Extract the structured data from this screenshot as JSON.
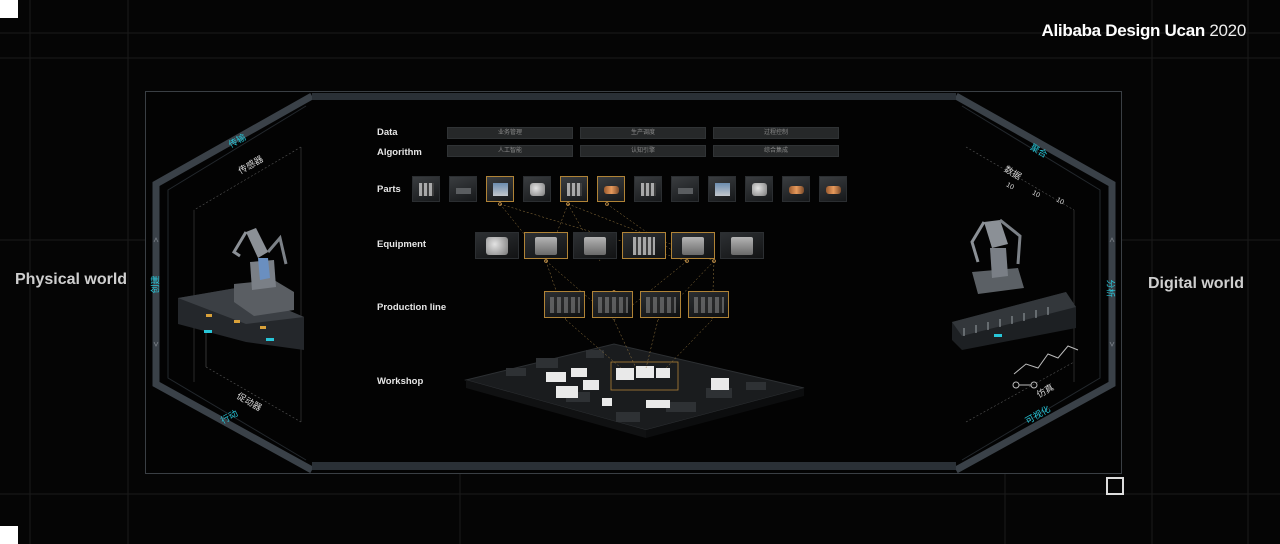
{
  "brand": {
    "name": "Alibaba Design Ucan",
    "year": "2020"
  },
  "left_title": "Physical world",
  "right_title": "Digital world",
  "rows": {
    "data": "Data",
    "algorithm": "Algorithm",
    "parts": "Parts",
    "equipment": "Equipment",
    "production_line": "Production line",
    "workshop": "Workshop"
  },
  "data_chips": [
    "业务管理",
    "生产调度",
    "过程控制"
  ],
  "algorithm_chips": [
    "人工智能",
    "认知引擎",
    "综合集成"
  ],
  "parts_tiles": [
    {
      "icon": "grid-cube-icon",
      "highlight": false
    },
    {
      "icon": "flat-plate-icon",
      "highlight": false
    },
    {
      "icon": "blue-cube-icon",
      "highlight": true
    },
    {
      "icon": "cylinder-part-icon",
      "highlight": false
    },
    {
      "icon": "grid-cube-icon",
      "highlight": true
    },
    {
      "icon": "copper-coil-icon",
      "highlight": true
    },
    {
      "icon": "grid-cube-icon",
      "highlight": false
    },
    {
      "icon": "flat-plate-icon",
      "highlight": false
    },
    {
      "icon": "blue-cube-icon",
      "highlight": false
    },
    {
      "icon": "cylinder-part-icon",
      "highlight": false
    },
    {
      "icon": "copper-coil-icon",
      "highlight": false
    },
    {
      "icon": "copper-coil-icon",
      "highlight": false
    }
  ],
  "equipment_tiles": [
    {
      "icon": "robot-arm-icon",
      "highlight": false
    },
    {
      "icon": "drum-machine-icon",
      "highlight": true
    },
    {
      "icon": "small-machine-icon",
      "highlight": false
    },
    {
      "icon": "press-machine-icon",
      "highlight": true
    },
    {
      "icon": "drum-machine-icon",
      "highlight": true
    },
    {
      "icon": "small-machine-icon",
      "highlight": false
    }
  ],
  "production_tiles": [
    {
      "icon": "assembly-line-icon"
    },
    {
      "icon": "assembly-line-icon"
    },
    {
      "icon": "assembly-line-icon"
    },
    {
      "icon": "assembly-line-icon"
    }
  ],
  "left_labels": {
    "top_edge": "传输",
    "left_edge": "创建",
    "bottom_edge": "行动",
    "sensor": "传感器",
    "actuator": "促动器"
  },
  "right_labels": {
    "top_edge": "聚合",
    "right_edge": "分析",
    "bottom_edge": "可视化",
    "data": "数据",
    "simulation": "仿真",
    "binary": [
      "10",
      "10",
      "10"
    ]
  },
  "colors": {
    "accent_cyan": "#28c6d8",
    "highlight_gold": "#b08336",
    "frame": "#3a4148",
    "panel_bg": "#030303"
  }
}
